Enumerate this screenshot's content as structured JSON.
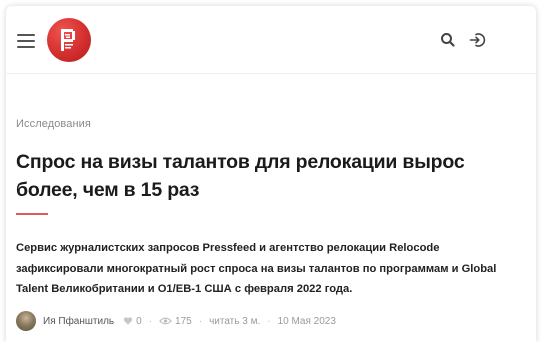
{
  "header": {
    "menu_icon": "hamburger-icon",
    "logo_icon": "pressfeed-logo",
    "search_icon": "search-icon",
    "login_icon": "login-icon",
    "brand_color": "#d32f2f"
  },
  "article": {
    "category": "Исследования",
    "title": "Спрос на визы талантов для релокации вырос более, чем в 15 раз",
    "lead": "Сервис журналистских запросов Pressfeed и агентство релокации Relocode зафиксировали многократный рост спроса на визы талантов по программам и Global Talent Великобритании и O1/EB-1 США с февраля 2022 года.",
    "accent_color": "#e05a57",
    "meta": {
      "author": "Ия Пфанштиль",
      "likes": "0",
      "views": "175",
      "read_time": "читать 3 м.",
      "date": "10 Мая 2023",
      "separator": "·"
    }
  }
}
